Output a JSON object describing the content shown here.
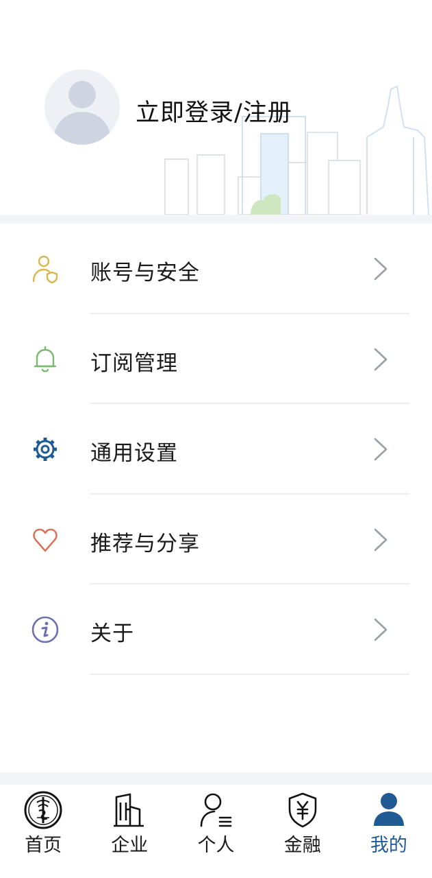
{
  "header": {
    "login_text": "立即登录/注册"
  },
  "menu": {
    "items": [
      {
        "label": "账号与安全",
        "icon": "account-security-icon",
        "color": "#d9b54a"
      },
      {
        "label": "订阅管理",
        "icon": "bell-icon",
        "color": "#7bb86f"
      },
      {
        "label": "通用设置",
        "icon": "gear-icon",
        "color": "#1f5a93"
      },
      {
        "label": "推荐与分享",
        "icon": "heart-icon",
        "color": "#d9745a"
      },
      {
        "label": "关于",
        "icon": "info-icon",
        "color": "#6a6fb0"
      }
    ]
  },
  "tabbar": {
    "tabs": [
      {
        "label": "首页",
        "icon": "home-emblem-icon"
      },
      {
        "label": "企业",
        "icon": "building-icon"
      },
      {
        "label": "个人",
        "icon": "person-list-icon"
      },
      {
        "label": "金融",
        "icon": "shield-yuan-icon"
      },
      {
        "label": "我的",
        "icon": "user-filled-icon",
        "active": true
      }
    ],
    "active_color": "#1f5a93"
  }
}
